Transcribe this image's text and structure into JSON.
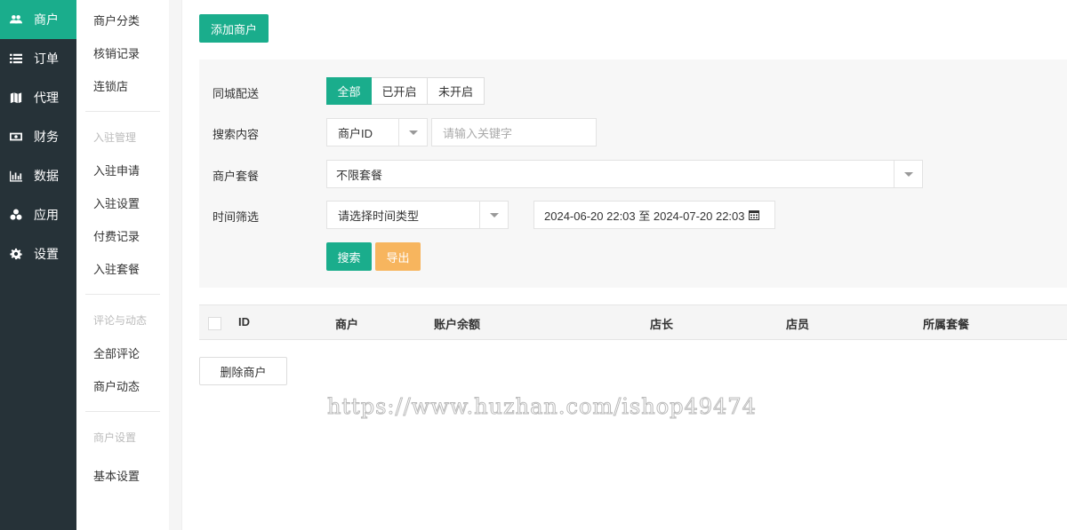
{
  "nav": {
    "items": [
      {
        "label": "商户",
        "icon": "users-icon",
        "active": true
      },
      {
        "label": "订单",
        "icon": "list-icon",
        "active": false
      },
      {
        "label": "代理",
        "icon": "map-icon",
        "active": false
      },
      {
        "label": "财务",
        "icon": "money-icon",
        "active": false
      },
      {
        "label": "数据",
        "icon": "bar-chart-icon",
        "active": false
      },
      {
        "label": "应用",
        "icon": "cubes-icon",
        "active": false
      },
      {
        "label": "设置",
        "icon": "gear-icon",
        "active": false
      }
    ]
  },
  "subnav": {
    "group1": [
      "商户分类",
      "核销记录",
      "连锁店"
    ],
    "section2": "入驻管理",
    "group2": [
      "入驻申请",
      "入驻设置",
      "付费记录",
      "入驻套餐"
    ],
    "section3": "评论与动态",
    "group3": [
      "全部评论",
      "商户动态"
    ],
    "section4": "商户设置",
    "group4": [
      "基本设置"
    ]
  },
  "main": {
    "add_button": "添加商户",
    "filter": {
      "delivery_label": "同城配送",
      "delivery_options": [
        "全部",
        "已开启",
        "未开启"
      ],
      "search_label": "搜索内容",
      "search_type": "商户ID",
      "search_placeholder": "请输入关键字",
      "package_label": "商户套餐",
      "package_value": "不限套餐",
      "time_label": "时间筛选",
      "time_type_value": "请选择时间类型",
      "date_range": "2024-06-20 22:03 至 2024-07-20 22:03",
      "search_button": "搜索",
      "export_button": "导出"
    },
    "table": {
      "columns": [
        "ID",
        "商户",
        "账户余额",
        "店长",
        "店员",
        "所属套餐"
      ]
    },
    "delete_button": "删除商户"
  },
  "watermark": "https://www.huzhan.com/ishop49474",
  "colors": {
    "accent": "#1aad8c",
    "warn": "#f7b55e",
    "nav_bg": "#263238"
  }
}
